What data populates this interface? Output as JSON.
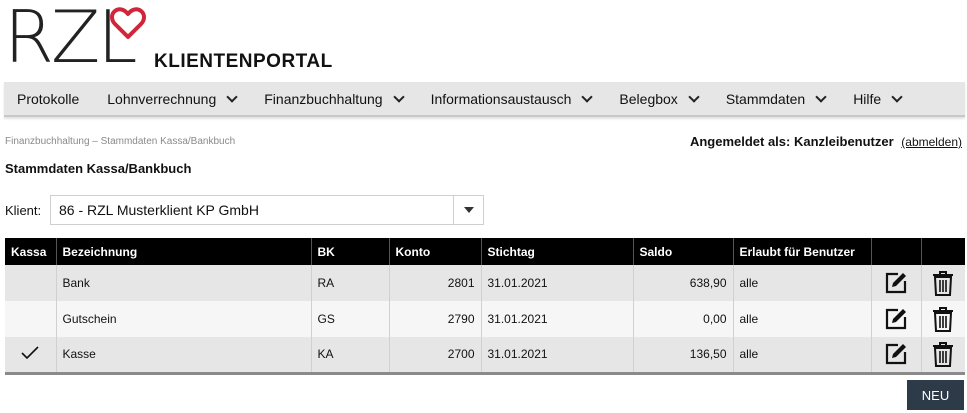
{
  "brand": {
    "logo_text": "RZL",
    "portal_title": "KLIENTENPORTAL",
    "accent_color": "#d0253a"
  },
  "nav": {
    "items": [
      {
        "label": "Protokolle",
        "has_dropdown": false
      },
      {
        "label": "Lohnverrechnung",
        "has_dropdown": true
      },
      {
        "label": "Finanzbuchhaltung",
        "has_dropdown": true
      },
      {
        "label": "Informationsaustausch",
        "has_dropdown": true
      },
      {
        "label": "Belegbox",
        "has_dropdown": true
      },
      {
        "label": "Stammdaten",
        "has_dropdown": true
      },
      {
        "label": "Hilfe",
        "has_dropdown": true
      }
    ]
  },
  "breadcrumb": "Finanzbuchhaltung – Stammdaten Kassa/Bankbuch",
  "login": {
    "prefix": "Angemeldet als:",
    "user": "Kanzleibenutzer",
    "logout_label": "(abmelden)"
  },
  "page_title": "Stammdaten Kassa/Bankbuch",
  "klient": {
    "label": "Klient:",
    "selected": "86 - RZL Musterklient KP GmbH"
  },
  "table": {
    "headers": [
      "Kassa",
      "Bezeichnung",
      "BK",
      "Konto",
      "Stichtag",
      "Saldo",
      "Erlaubt für Benutzer",
      "",
      ""
    ],
    "rows": [
      {
        "kassa": "",
        "bezeichnung": "Bank",
        "bk": "RA",
        "konto": "2801",
        "stichtag": "31.01.2021",
        "saldo": "638,90",
        "erlaubt": "alle",
        "is_kassa": false
      },
      {
        "kassa": "",
        "bezeichnung": "Gutschein",
        "bk": "GS",
        "konto": "2790",
        "stichtag": "31.01.2021",
        "saldo": "0,00",
        "erlaubt": "alle",
        "is_kassa": false
      },
      {
        "kassa": "✓",
        "bezeichnung": "Kasse",
        "bk": "KA",
        "konto": "2700",
        "stichtag": "31.01.2021",
        "saldo": "136,50",
        "erlaubt": "alle",
        "is_kassa": true
      }
    ]
  },
  "actions": {
    "new_label": "NEU"
  }
}
